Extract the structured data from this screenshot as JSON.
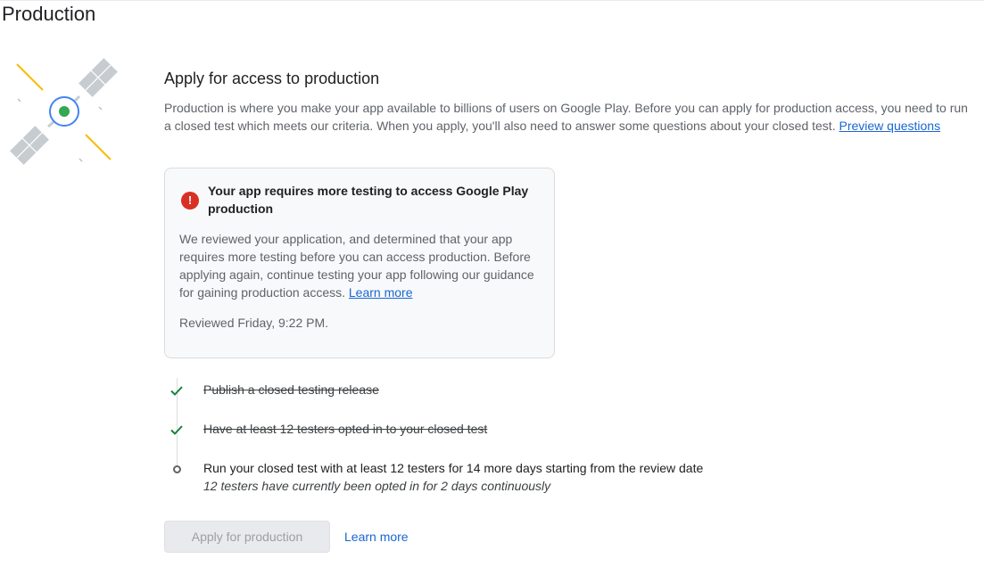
{
  "page": {
    "title": "Production"
  },
  "apply_section": {
    "heading": "Apply for access to production",
    "intro_text": "Production is where you make your app available to billions of users on Google Play. Before you can apply for production access, you need to run a closed test which meets our criteria. When you apply, you'll also need to answer some questions about your closed test. ",
    "preview_link": "Preview questions"
  },
  "alert": {
    "icon": "error-icon",
    "icon_glyph": "!",
    "title": "Your app requires more testing to access Google Play production",
    "body": "We reviewed your application, and determined that your app requires more testing before you can access production. Before applying again, continue testing your app following our guidance for gaining production access. ",
    "learn_more": "Learn more",
    "reviewed": "Reviewed Friday, 9:22 PM."
  },
  "checklist": {
    "items": [
      {
        "label": "Publish a closed testing release",
        "status": "complete",
        "icon": "checkmark-icon"
      },
      {
        "label": "Have at least 12 testers opted in to your closed test",
        "status": "complete",
        "icon": "checkmark-icon"
      },
      {
        "label": "Run your closed test with at least 12 testers for 14 more days starting from the review date",
        "status": "pending",
        "icon": "pending-circle-icon",
        "sub": "12 testers have currently been opted in for 2 days continuously"
      }
    ]
  },
  "actions": {
    "apply_label": "Apply for production",
    "apply_enabled": false,
    "learn_more_label": "Learn more"
  },
  "colors": {
    "link": "#1967d2",
    "error": "#d93025",
    "check": "#188038",
    "satellite_ring": "#4285f4",
    "satellite_core": "#34a853",
    "satellite_panel": "#c7ccd1",
    "satellite_beam": "#fbbc04"
  }
}
